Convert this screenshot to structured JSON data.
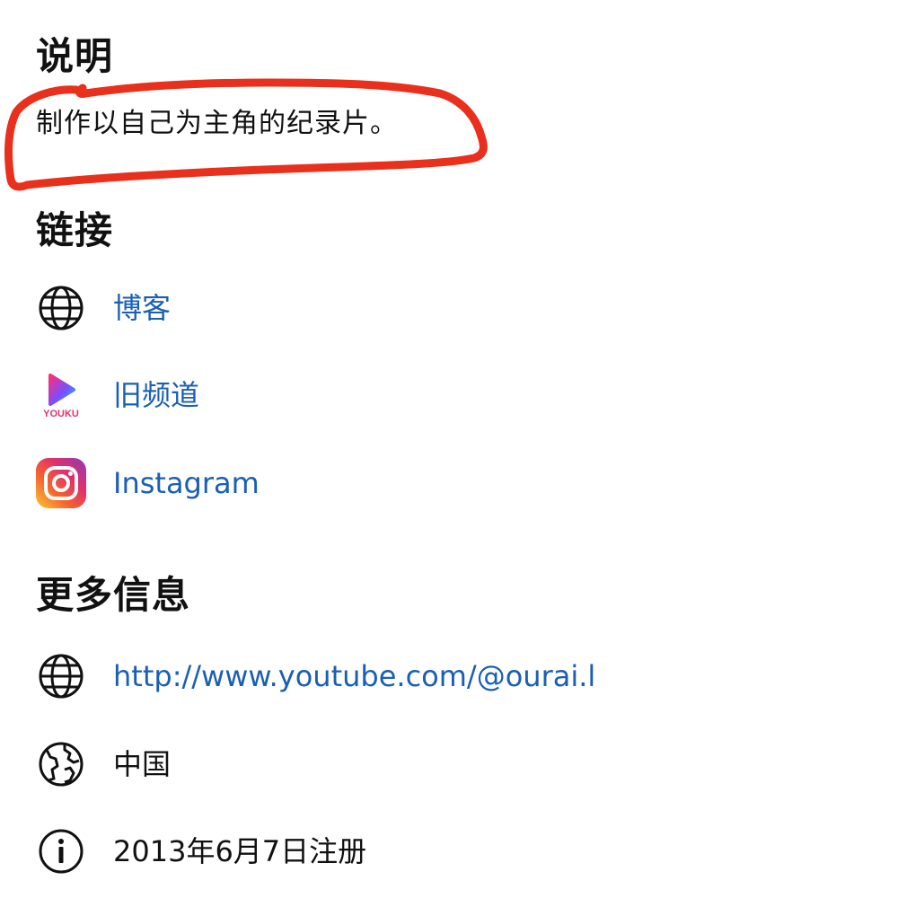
{
  "description": {
    "heading": "说明",
    "text": "制作以自己为主角的纪录片。"
  },
  "links": {
    "heading": "链接",
    "items": [
      {
        "label": "博客",
        "icon": "globe-icon"
      },
      {
        "label": "旧频道",
        "icon": "youku-icon"
      },
      {
        "label": "Instagram",
        "icon": "instagram-icon"
      }
    ]
  },
  "more_info": {
    "heading": "更多信息",
    "items": [
      {
        "label": "http://www.youtube.com/@ourai.l",
        "icon": "globe-icon"
      },
      {
        "label": "中国",
        "icon": "earth-icon"
      },
      {
        "label": "2013年6月7日注册",
        "icon": "info-icon"
      }
    ]
  },
  "youku_logo_text": "YOUKU",
  "colors": {
    "link": "#1a5fb4",
    "annotation": "#e8301c",
    "text": "#111111"
  }
}
